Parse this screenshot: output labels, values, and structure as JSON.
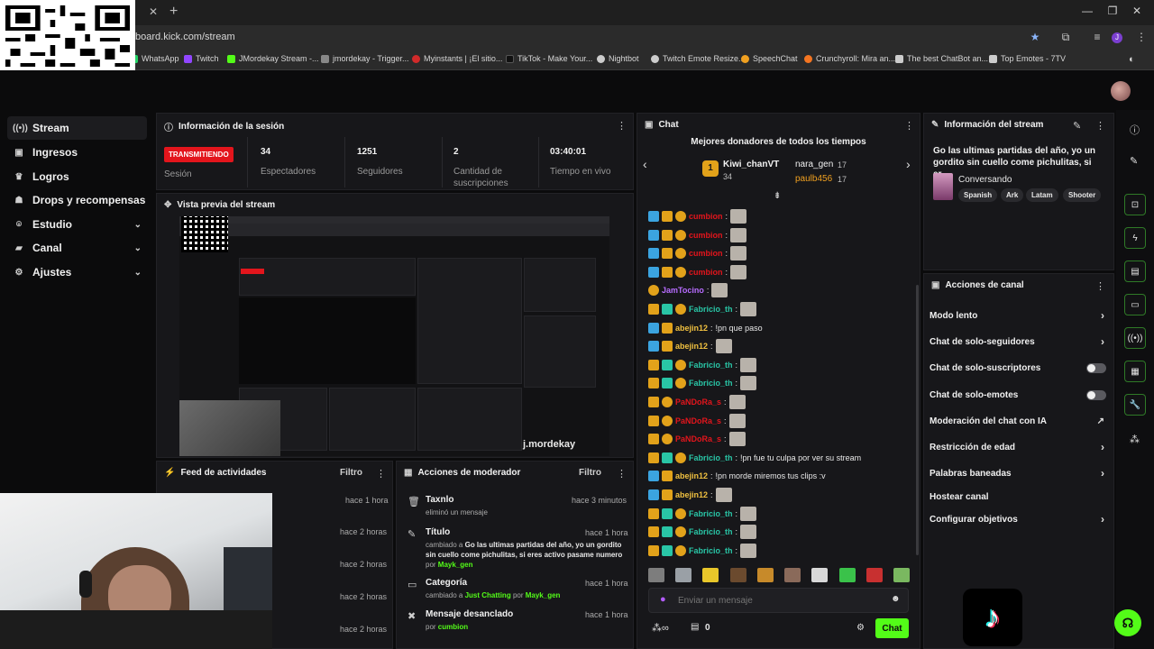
{
  "browser": {
    "url": "board.kick.com/stream",
    "bookmarks": [
      {
        "label": "WhatsApp",
        "color": "#25d366",
        "icon": "whatsapp-icon"
      },
      {
        "label": "Twitch",
        "color": "#9146ff",
        "icon": "twitch-icon"
      },
      {
        "label": "JMordekay Stream -...",
        "color": "#53fc18",
        "icon": "kick-icon"
      },
      {
        "label": "jmordekay - Trigger...",
        "color": "#888888",
        "icon": "globe-icon"
      },
      {
        "label": "Myinstants | ¡El sitio...",
        "color": "#d12a2a",
        "icon": "myinstants-icon"
      },
      {
        "label": "TikTok - Make Your...",
        "color": "#111111",
        "icon": "tiktok-icon"
      },
      {
        "label": "Nightbot",
        "color": "#cccccc",
        "icon": "nightbot-icon"
      },
      {
        "label": "Twitch Emote Resize...",
        "color": "#cccccc",
        "icon": "globe-icon"
      },
      {
        "label": "SpeechChat",
        "color": "#f0a020",
        "icon": "speechchat-icon"
      },
      {
        "label": "Crunchyroll: Mira an...",
        "color": "#f47521",
        "icon": "crunchyroll-icon"
      },
      {
        "label": "The best ChatBot an...",
        "color": "#cccccc",
        "icon": "chatbot-icon"
      },
      {
        "label": "Top Emotes - 7TV",
        "color": "#cccccc",
        "icon": "7tv-icon"
      }
    ]
  },
  "sidebar": {
    "items": [
      {
        "label": "Stream",
        "icon": "broadcast-icon",
        "active": true
      },
      {
        "label": "Ingresos",
        "icon": "money-icon"
      },
      {
        "label": "Logros",
        "icon": "trophy-icon"
      },
      {
        "label": "Drops y recompensas",
        "icon": "users-icon"
      },
      {
        "label": "Estudio",
        "icon": "studio-icon",
        "chevron": true
      },
      {
        "label": "Canal",
        "icon": "channel-icon",
        "chevron": true
      },
      {
        "label": "Ajustes",
        "icon": "gear-icon",
        "chevron": true
      }
    ]
  },
  "session": {
    "title": "Información de la sesión",
    "badge": "TRANSMITIENDO",
    "badge_sub": "Sesión",
    "stats": [
      {
        "value": "34",
        "label": "Espectadores"
      },
      {
        "value": "1251",
        "label": "Seguidores"
      },
      {
        "value": "2",
        "label": "Cantidad de suscripciones"
      },
      {
        "value": "03:40:01",
        "label": "Tiempo en vivo"
      }
    ]
  },
  "preview": {
    "title": "Vista previa del stream",
    "watermark": "j.mordekay"
  },
  "activity": {
    "title": "Feed de actividades",
    "filter": "Filtro",
    "times": [
      "hace 1 hora",
      "hace 2 horas",
      "hace 2 horas",
      "hace 2 horas",
      "hace 2 horas"
    ]
  },
  "moderator": {
    "title": "Acciones de moderador",
    "filter": "Filtro",
    "items": [
      {
        "title": "Taxnlo",
        "time": "hace 3 minutos",
        "text": "eliminó un mensaje"
      },
      {
        "title": "Título",
        "time": "hace 1 hora",
        "text_pre": "cambiado a",
        "highlight": "Go las ultimas partidas del año, yo un gordito sin cuello come pichulitas, si eres activo pasame numero",
        "by_pre": "por",
        "by": "Mayk_gen"
      },
      {
        "title": "Categoría",
        "time": "hace 1 hora",
        "text_pre": "cambiado a",
        "highlight": "Just Chatting",
        "by_pre": "por",
        "by": "Mayk_gen"
      },
      {
        "title": "Mensaje desanclado",
        "time": "hace 1 hora",
        "by_pre": "por",
        "by": "cumbion"
      }
    ]
  },
  "chat": {
    "title": "Chat",
    "donors_title": "Mejores donadores de todos los tiempos",
    "donors": [
      {
        "rank": "1",
        "name": "Kiwi_chanVT",
        "amount": "34"
      },
      {
        "name": "nara_gen",
        "amount": "17"
      },
      {
        "name": "paulb456",
        "amount": "17"
      }
    ],
    "messages": [
      {
        "user": "cumbion",
        "color": "#e3151c",
        "badges": [
          "blue",
          "gold",
          "sub"
        ],
        "text": "",
        "emote": true
      },
      {
        "user": "cumbion",
        "color": "#e3151c",
        "badges": [
          "blue",
          "gold",
          "sub"
        ],
        "text": "",
        "emote": true
      },
      {
        "user": "cumbion",
        "color": "#e3151c",
        "badges": [
          "blue",
          "gold",
          "sub"
        ],
        "text": "",
        "emote": true
      },
      {
        "user": "cumbion",
        "color": "#e3151c",
        "badges": [
          "blue",
          "gold",
          "sub"
        ],
        "text": "",
        "emote": true
      },
      {
        "user": "JamTocino",
        "color": "#b76cff",
        "badges": [
          "sub"
        ],
        "text": "",
        "emote": true
      },
      {
        "user": "Fabricio_th",
        "color": "#29c5a6",
        "badges": [
          "gold",
          "green",
          "sub"
        ],
        "text": "",
        "emote": true
      },
      {
        "user": "abejin12",
        "color": "#f0c040",
        "badges": [
          "blue",
          "gold"
        ],
        "text": "!pn que paso",
        "emote": false
      },
      {
        "user": "abejin12",
        "color": "#f0c040",
        "badges": [
          "blue",
          "gold"
        ],
        "text": "",
        "emote": true
      },
      {
        "user": "Fabricio_th",
        "color": "#29c5a6",
        "badges": [
          "gold",
          "green",
          "sub"
        ],
        "text": "",
        "emote": true
      },
      {
        "user": "Fabricio_th",
        "color": "#29c5a6",
        "badges": [
          "gold",
          "green",
          "sub"
        ],
        "text": "",
        "emote": true
      },
      {
        "user": "PaNDoRa_s",
        "color": "#e3151c",
        "badges": [
          "gold",
          "sub"
        ],
        "text": "",
        "emote": true
      },
      {
        "user": "PaNDoRa_s",
        "color": "#e3151c",
        "badges": [
          "gold",
          "sub"
        ],
        "text": "",
        "emote": true
      },
      {
        "user": "PaNDoRa_s",
        "color": "#e3151c",
        "badges": [
          "gold",
          "sub"
        ],
        "text": "",
        "emote": true
      },
      {
        "user": "Fabricio_th",
        "color": "#29c5a6",
        "badges": [
          "gold",
          "green",
          "sub"
        ],
        "text": "!pn fue tu culpa por ver su stream",
        "emote": false
      },
      {
        "user": "abejin12",
        "color": "#f0c040",
        "badges": [
          "blue",
          "gold"
        ],
        "text": "!pn morde miremos tus clips :v",
        "emote": false
      },
      {
        "user": "abejin12",
        "color": "#f0c040",
        "badges": [
          "blue",
          "gold"
        ],
        "text": "",
        "emote": true
      },
      {
        "user": "Fabricio_th",
        "color": "#29c5a6",
        "badges": [
          "gold",
          "green",
          "sub"
        ],
        "text": "",
        "emote": true
      },
      {
        "user": "Fabricio_th",
        "color": "#29c5a6",
        "badges": [
          "gold",
          "green",
          "sub"
        ],
        "text": "",
        "emote": true
      },
      {
        "user": "Fabricio_th",
        "color": "#29c5a6",
        "badges": [
          "gold",
          "green",
          "sub"
        ],
        "text": "",
        "emote": true
      }
    ],
    "input_placeholder": "Enviar un mensaje",
    "points": "0",
    "send_label": "Chat"
  },
  "stream_info": {
    "title": "Información del stream",
    "stream_title": "Go las ultimas partidas del año, yo un gordito sin cuello come pichulitas, si er...",
    "category": "Conversando",
    "tags": [
      "Spanish",
      "Ark",
      "Latam",
      "Shooter"
    ]
  },
  "channel_actions": {
    "title": "Acciones de canal",
    "items": [
      {
        "label": "Modo lento",
        "control": "arrow"
      },
      {
        "label": "Chat de solo-seguidores",
        "control": "arrow"
      },
      {
        "label": "Chat de solo-suscriptores",
        "control": "toggle"
      },
      {
        "label": "Chat de solo-emotes",
        "control": "toggle"
      },
      {
        "label": "Moderación del chat con IA",
        "control": "external"
      },
      {
        "label": "Restricción de edad",
        "control": "arrow"
      },
      {
        "label": "Palabras baneadas",
        "control": "arrow"
      },
      {
        "label": "Hostear canal",
        "control": "none"
      },
      {
        "label": "Configurar objetivos",
        "control": "arrow"
      }
    ]
  },
  "colors": {
    "accent": "#53fc18",
    "live": "#e3151c"
  }
}
